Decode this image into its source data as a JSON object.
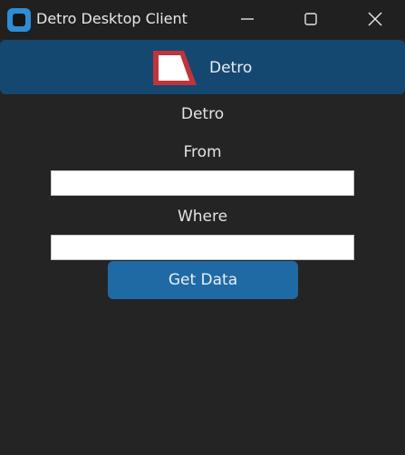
{
  "window": {
    "title": "Detro Desktop Client",
    "icon": "app-icon"
  },
  "title_bar_controls": {
    "minimize_icon": "minimize-icon",
    "maximize_icon": "maximize-icon",
    "close_icon": "close-icon"
  },
  "banner": {
    "title": "Detro",
    "logo": "detro-logo",
    "background": "#144870",
    "logo_color": "#c0343b"
  },
  "form": {
    "app_name": "Detro",
    "from_label": "From",
    "from_value": "",
    "where_label": "Where",
    "where_value": "",
    "submit_label": "Get Data",
    "submit_color": "#1f6aa5"
  },
  "colors": {
    "window_background": "#242424",
    "title_bar": "#202020",
    "text": "#e3e3e3"
  }
}
